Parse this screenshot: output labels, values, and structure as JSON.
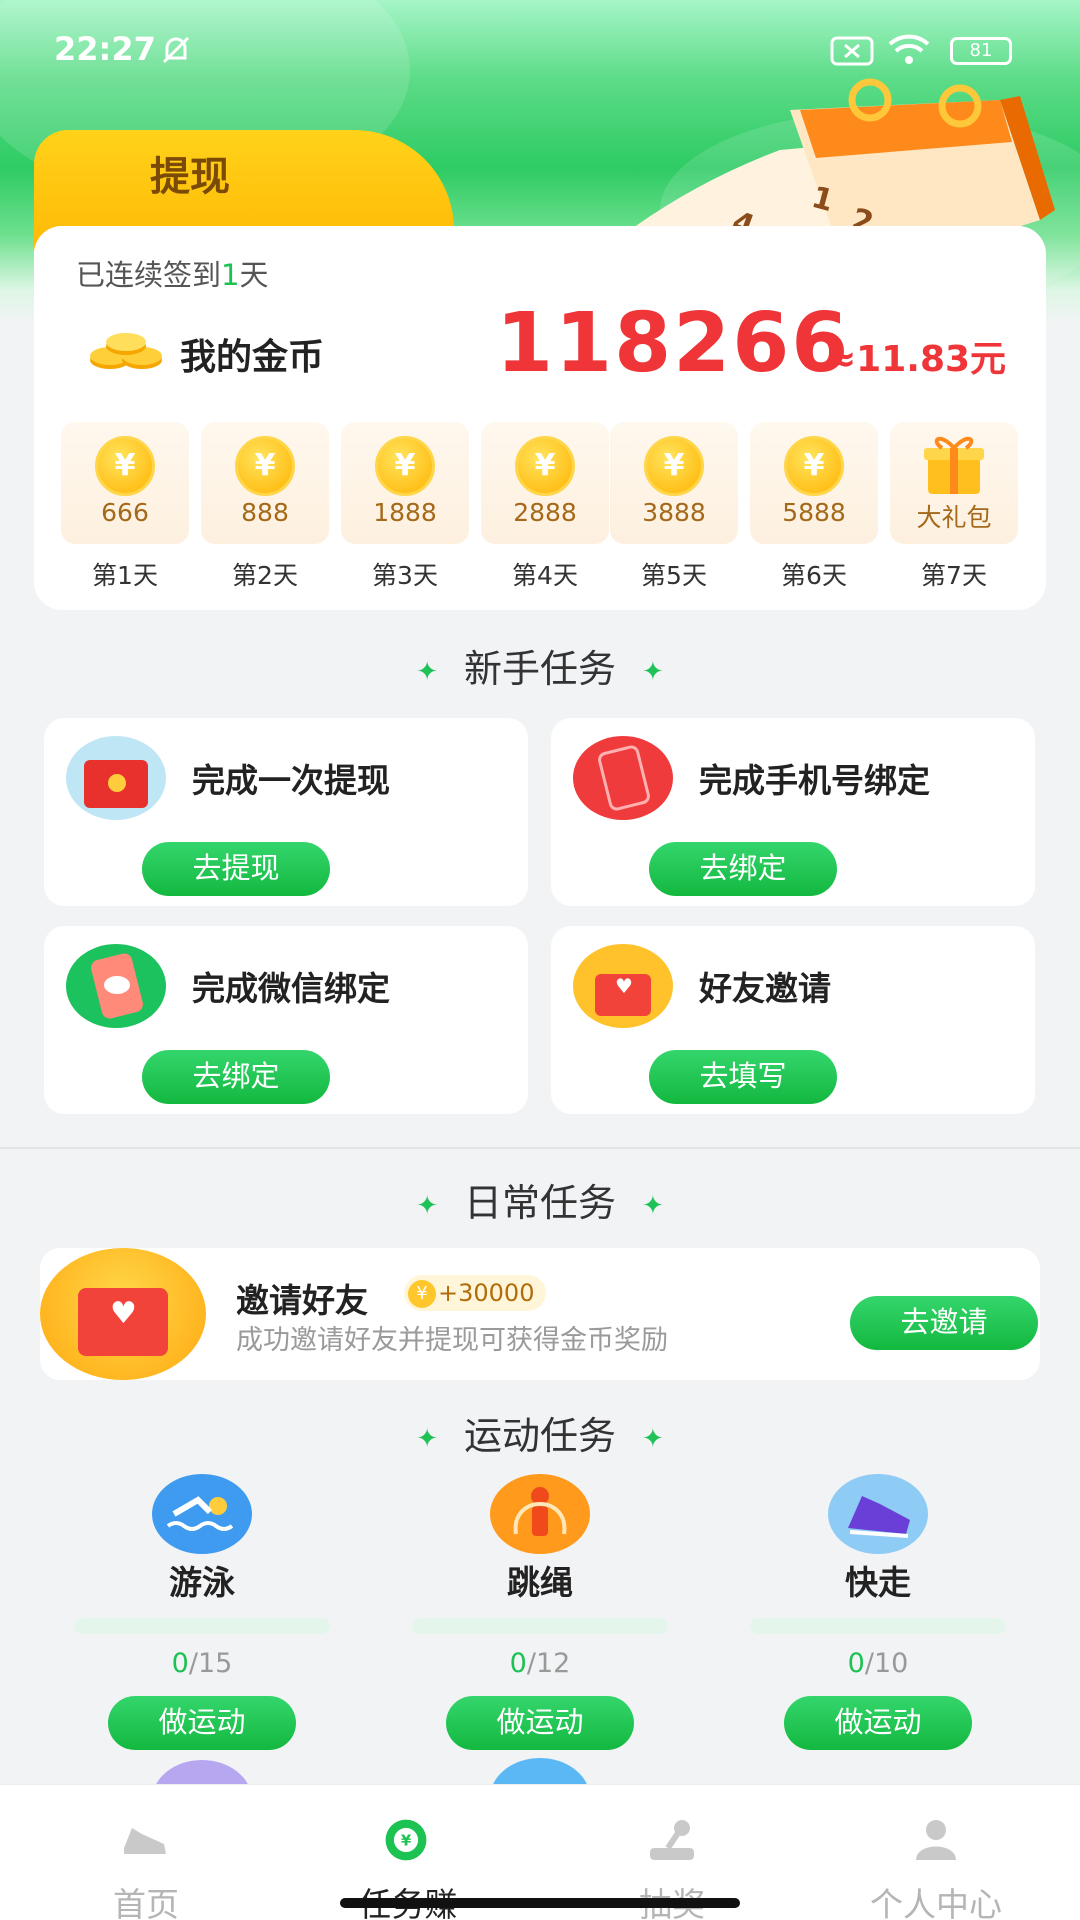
{
  "status_bar": {
    "time": "22:27",
    "battery": "81"
  },
  "signin": {
    "tab_label": "提现",
    "streak_prefix": "已连续签到",
    "streak_days": "1",
    "streak_suffix": "天",
    "coins_label": "我的金币",
    "coins_total": "118266",
    "coins_value": "≈11.83元",
    "days": [
      {
        "amount": "666",
        "label": "第1天"
      },
      {
        "amount": "888",
        "label": "第2天"
      },
      {
        "amount": "1888",
        "label": "第3天"
      },
      {
        "amount": "2888",
        "label": "第4天"
      },
      {
        "amount": "3888",
        "label": "第5天"
      },
      {
        "amount": "5888",
        "label": "第6天"
      },
      {
        "amount": "大礼包",
        "label": "第7天"
      }
    ]
  },
  "newbie": {
    "title": "新手任务",
    "tasks": [
      {
        "title": "完成一次提现",
        "button": "去提现"
      },
      {
        "title": "完成手机号绑定",
        "button": "去绑定"
      },
      {
        "title": "完成微信绑定",
        "button": "去绑定"
      },
      {
        "title": "好友邀请",
        "button": "去填写"
      }
    ]
  },
  "daily": {
    "title": "日常任务",
    "invite": {
      "title": "邀请好友",
      "reward": "+30000",
      "desc": "成功邀请好友并提现可获得金币奖励",
      "button": "去邀请"
    }
  },
  "sports": {
    "title": "运动任务",
    "items": [
      {
        "name": "游泳",
        "done": "0",
        "total": "/15",
        "progress": 0,
        "button": "做运动"
      },
      {
        "name": "跳绳",
        "done": "0",
        "total": "/12",
        "progress": 0,
        "button": "做运动"
      },
      {
        "name": "快走",
        "done": "0",
        "total": "/10",
        "progress": 0,
        "button": "做运动"
      }
    ]
  },
  "tabbar": {
    "items": [
      {
        "label": "首页",
        "active": false
      },
      {
        "label": "任务赚",
        "active": true
      },
      {
        "label": "抽奖",
        "active": false
      },
      {
        "label": "个人中心",
        "active": false
      }
    ]
  },
  "colors": {
    "accent": "#1cc252",
    "coin_red": "#ef3538",
    "gold": "#ffb300"
  }
}
